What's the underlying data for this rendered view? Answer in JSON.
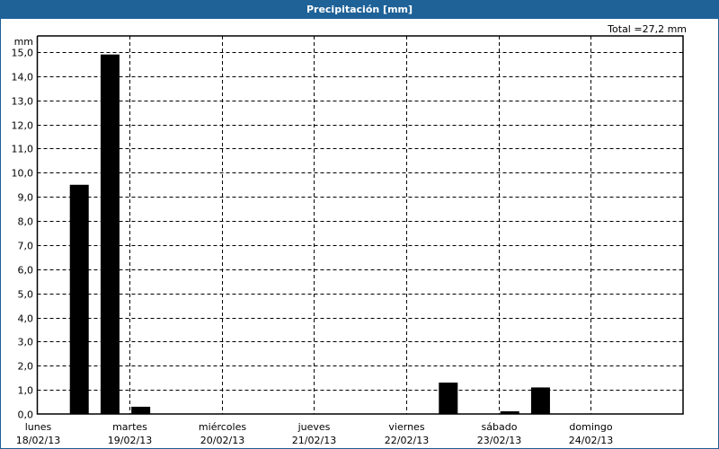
{
  "chart_data": {
    "type": "bar",
    "title": "Precipitación [mm]",
    "ylabel": "mm",
    "total_label": "Total =27,2 mm",
    "ylim": [
      0,
      15.67
    ],
    "yticks": [
      "0,0",
      "1,0",
      "2,0",
      "3,0",
      "4,0",
      "5,0",
      "6,0",
      "7,0",
      "8,0",
      "9,0",
      "10,0",
      "11,0",
      "12,0",
      "13,0",
      "14,0",
      "15,0"
    ],
    "days": [
      {
        "name": "lunes",
        "date": "18/02/13"
      },
      {
        "name": "martes",
        "date": "19/02/13"
      },
      {
        "name": "miércoles",
        "date": "20/02/13"
      },
      {
        "name": "jueves",
        "date": "21/02/13"
      },
      {
        "name": "viernes",
        "date": "22/02/13"
      },
      {
        "name": "sábado",
        "date": "23/02/13"
      },
      {
        "name": "domingo",
        "date": "24/02/13"
      }
    ],
    "bins_per_day": 3,
    "values": [
      0,
      9.5,
      14.9,
      0.3,
      0,
      0,
      0,
      0,
      0,
      0,
      0,
      0,
      0,
      1.3,
      0,
      0.11,
      1.1,
      0,
      0,
      0,
      0
    ],
    "grid": true,
    "bar_color": "#000000",
    "header_color": "#1f6298"
  }
}
